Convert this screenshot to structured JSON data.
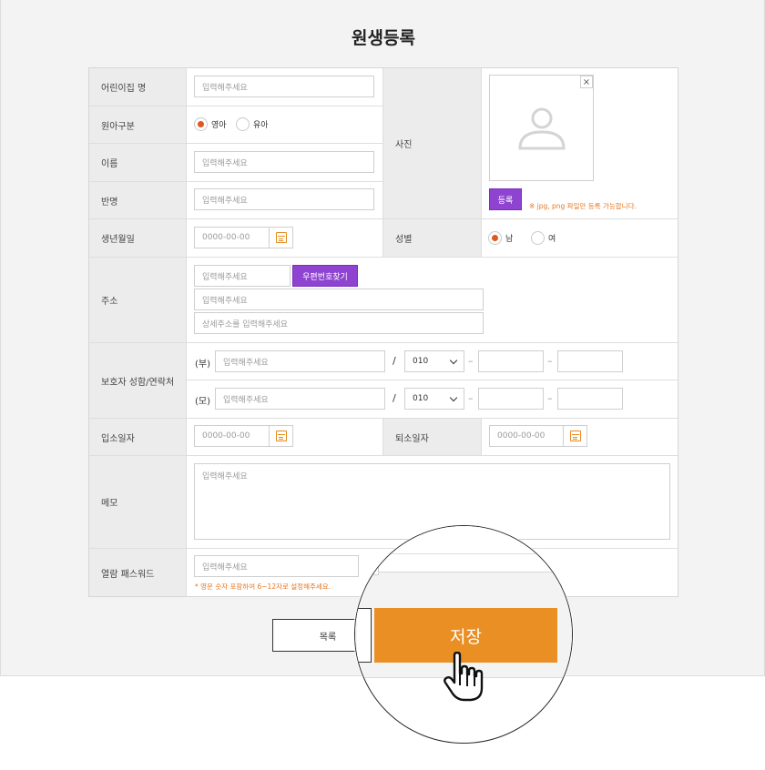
{
  "page": {
    "title": "원생등록"
  },
  "form": {
    "placeholder": "입력해주세요",
    "date_placeholder": "0000-00-00",
    "daycare_name": {
      "label": "어린이집 명"
    },
    "child_type": {
      "label": "원아구분",
      "options": [
        "영아",
        "유아"
      ],
      "selected": "영아"
    },
    "name": {
      "label": "이름"
    },
    "class_name": {
      "label": "반명"
    },
    "photo": {
      "label": "사진",
      "close_glyph": "×",
      "register_label": "등록",
      "note": "※ jpg, png 파일만 등록 가능합니다."
    },
    "birthdate": {
      "label": "생년월일"
    },
    "gender": {
      "label": "성별",
      "options": [
        "남",
        "여"
      ],
      "selected": "남"
    },
    "address": {
      "label": "주소",
      "zip_button": "우편번호찾기",
      "detail_placeholder": "상세주소를 입력해주세요"
    },
    "guardian": {
      "label": "보호자 성함/연락처",
      "father_prefix": "(부)",
      "mother_prefix": "(모)",
      "slash": "/",
      "dash": "–",
      "phone_prefix_value": "010"
    },
    "admission_date": {
      "label": "입소일자"
    },
    "leave_date": {
      "label": "퇴소일자"
    },
    "memo": {
      "label": "메모"
    },
    "view_password": {
      "label": "열람 패스워드",
      "note": "* 영문 숫자 포함하여 6~12자로 설정해주세요."
    }
  },
  "actions": {
    "list_label": "목록",
    "save_label": "저장"
  },
  "colors": {
    "accent_orange": "#e98f24",
    "accent_purple": "#8e44d0",
    "radio_on": "#e2561f",
    "note_orange": "#e8761f"
  },
  "icons": {
    "calendar": "calendar-icon",
    "person": "person-placeholder-icon",
    "cursor": "hand-pointer-icon",
    "close": "close-icon",
    "chevron": "chevron-down-icon"
  }
}
